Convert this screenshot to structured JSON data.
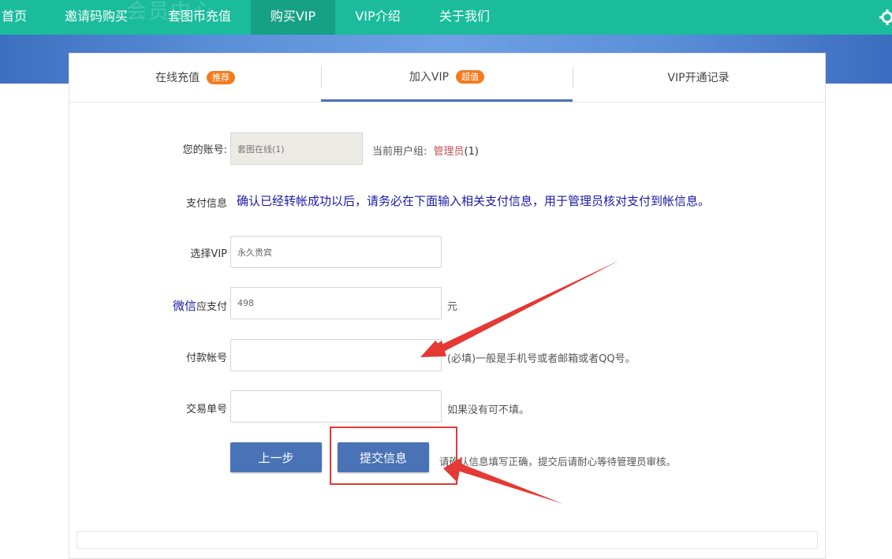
{
  "nav": {
    "watermark": "会员中心",
    "items": [
      {
        "label": "首页",
        "active": false
      },
      {
        "label": "邀请码购买",
        "active": false
      },
      {
        "label": "套图币充值",
        "active": false
      },
      {
        "label": "购买VIP",
        "active": true
      },
      {
        "label": "VIP介绍",
        "active": false
      },
      {
        "label": "关于我们",
        "active": false
      }
    ]
  },
  "tabs": [
    {
      "label": "在线充值",
      "badge": "推荐"
    },
    {
      "label": "加入VIP",
      "badge": "超值"
    },
    {
      "label": "VIP开通记录",
      "badge": ""
    }
  ],
  "form": {
    "account_label": "您的账号:",
    "account_value": "套图在线(1)",
    "group_label": "当前用户组:",
    "group_name": "管理员",
    "group_suffix": "(1)",
    "payinfo_label": "支付信息",
    "payinfo_text": "确认已经转帐成功以后，请务必在下面输入相关支付信息，用于管理员核对支付到帐信息。",
    "vip_label": "选择VIP",
    "vip_value": "永久贵宾",
    "method_label": "微信",
    "pay_label": "应支付",
    "pay_value": "498",
    "pay_unit": "元",
    "payer_label": "付款帐号",
    "payer_value": "",
    "payer_hint": "(必填)一般是手机号或者邮箱或者QQ号。",
    "order_label": "交易单号",
    "order_value": "",
    "order_hint": "如果没有可不填。",
    "prev_button": "上一步",
    "submit_button": "提交信息",
    "submit_hint": "请确认信息填写正确，提交后请耐心等待管理员审核。"
  },
  "colors": {
    "nav_bg": "#1abc9c",
    "nav_active": "#16a085",
    "accent_blue": "#4a73b7",
    "badge_orange": "#f47b20",
    "highlight_red": "#e53935",
    "group_name": "#c0504d",
    "info_text": "#1a1aa6"
  }
}
